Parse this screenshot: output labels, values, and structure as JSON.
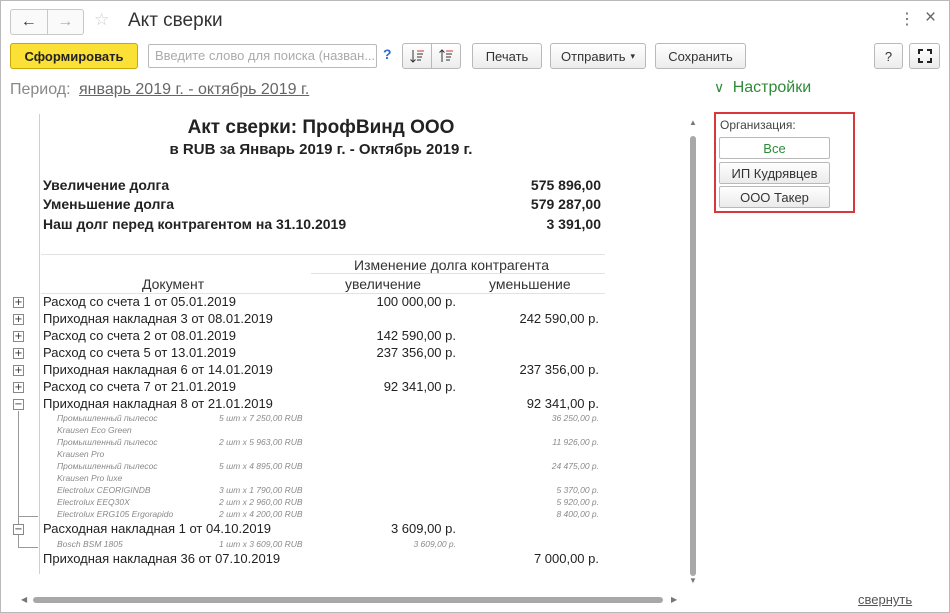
{
  "window": {
    "title": "Акт сверки",
    "back": "←",
    "forward": "→",
    "star": "☆",
    "more": "⋮",
    "close": "×"
  },
  "toolbar": {
    "generate": "Сформировать",
    "search_placeholder": "Введите слово для поиска (назван...",
    "help_q": "?",
    "print": "Печать",
    "send": "Отправить",
    "send_arrow": "▾",
    "save": "Сохранить",
    "help": "?",
    "fullscreen": "⛶"
  },
  "period": {
    "label": "Период:",
    "value": "январь 2019 г. - октябрь 2019 г."
  },
  "report": {
    "title": "Акт сверки: ПрофВинд ООО",
    "subtitle": "в RUB за Январь 2019 г. - Октябрь 2019 г.",
    "summary": [
      {
        "label": "Увеличение долга",
        "value": "575 896,00"
      },
      {
        "label": "Уменьшение долга",
        "value": "579 287,00"
      },
      {
        "label": "Наш долг перед контрагентом на 31.10.2019",
        "value": "3 391,00"
      }
    ],
    "headers": {
      "group": "Изменение долга контрагента",
      "document": "Документ",
      "increase": "увеличение",
      "decrease": "уменьшение"
    },
    "rows": [
      {
        "toggle": "+",
        "doc": "Расход со счета 1 от 05.01.2019",
        "inc": "100 000,00 р.",
        "dec": ""
      },
      {
        "toggle": "+",
        "doc": "Приходная накладная 3 от 08.01.2019",
        "inc": "",
        "dec": "242 590,00 р."
      },
      {
        "toggle": "+",
        "doc": "Расход со счета 2 от 08.01.2019",
        "inc": "142 590,00 р.",
        "dec": ""
      },
      {
        "toggle": "+",
        "doc": "Расход со счета 5 от 13.01.2019",
        "inc": "237 356,00 р.",
        "dec": ""
      },
      {
        "toggle": "+",
        "doc": "Приходная накладная 6 от 14.01.2019",
        "inc": "",
        "dec": "237 356,00 р."
      },
      {
        "toggle": "+",
        "doc": "Расход со счета 7 от 21.01.2019",
        "inc": "92 341,00 р.",
        "dec": ""
      },
      {
        "toggle": "−",
        "doc": "Приходная накладная 8 от 21.01.2019",
        "inc": "",
        "dec": "92 341,00 р."
      }
    ],
    "details_8": [
      {
        "name": "Промышленный пылесос",
        "qty": "5 шт x 7 250,00 RUB",
        "sum": "36 250,00 р."
      },
      {
        "name": "Krausen Eco Green",
        "qty": "",
        "sum": ""
      },
      {
        "name": "Промышленный пылесос",
        "qty": "2 шт x 5 963,00 RUB",
        "sum": "11 926,00 р."
      },
      {
        "name": "Krausen Pro",
        "qty": "",
        "sum": ""
      },
      {
        "name": "Промышленный пылесос",
        "qty": "5 шт x 4 895,00 RUB",
        "sum": "24 475,00 р."
      },
      {
        "name": "Krausen Pro luxe",
        "qty": "",
        "sum": ""
      },
      {
        "name": "Electrolux CEORIGINDB",
        "qty": "3 шт x 1 790,00 RUB",
        "sum": "5 370,00 р."
      },
      {
        "name": "Electrolux EEQ30X",
        "qty": "2 шт x 2 960,00 RUB",
        "sum": "5 920,00 р."
      },
      {
        "name": "Electrolux ERG105 Ergorapido",
        "qty": "2 шт x 4 200,00 RUB",
        "sum": "8 400,00 р."
      }
    ],
    "row_1": {
      "toggle": "−",
      "doc": "Расходная накладная 1 от 04.10.2019",
      "inc": "3 609,00 р.",
      "dec": ""
    },
    "details_1": [
      {
        "name": "Bosch BSM 1805",
        "qty": "1 шт x 3 609,00 RUB",
        "sum": "3 609,00 р."
      }
    ],
    "row_36": {
      "doc": "Приходная накладная 36 от 07.10.2019",
      "inc": "",
      "dec": "7 000,00 р."
    }
  },
  "settings": {
    "title": "Настройки",
    "chevron": "∨",
    "org_label": "Организация:",
    "org_options": [
      "Все",
      "ИП Кудрявцев",
      "ООО Такер"
    ],
    "selected": "Все"
  },
  "collapse": "свернуть",
  "colors": {
    "primary_button": "#fbe036",
    "settings_green": "#2e8b3a",
    "highlight_red": "#d9383a"
  }
}
